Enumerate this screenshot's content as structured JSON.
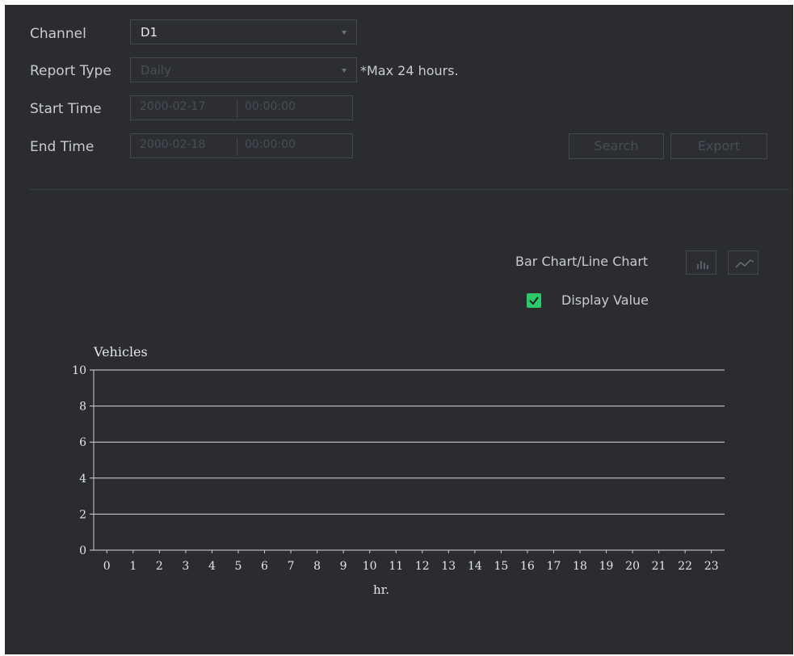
{
  "form": {
    "channel_label": "Channel",
    "channel_value": "D1",
    "report_type_label": "Report Type",
    "report_type_value": "Daily",
    "max_note": "*Max 24 hours.",
    "start_time_label": "Start Time",
    "start_date": "2000-02-17",
    "start_time": "00:00:00",
    "end_time_label": "End Time",
    "end_date": "2000-02-18",
    "end_time": "00:00:00",
    "search_label": "Search",
    "export_label": "Export"
  },
  "chart_controls": {
    "toggle_label": "Bar Chart/Line Chart",
    "display_value_label": "Display Value",
    "display_value_checked": true
  },
  "colors": {
    "panel_bg": "#2a2c30",
    "accent_green": "#2bc96b",
    "text": "#c9cbd0",
    "disabled": "#4a4d53"
  },
  "chart_data": {
    "type": "bar",
    "ylabel": "Vehicles",
    "xlabel": "hr.",
    "ylim": [
      0,
      10
    ],
    "yticks": [
      0,
      2,
      4,
      6,
      8,
      10
    ],
    "categories": [
      "0",
      "1",
      "2",
      "3",
      "4",
      "5",
      "6",
      "7",
      "8",
      "9",
      "10",
      "11",
      "12",
      "13",
      "14",
      "15",
      "16",
      "17",
      "18",
      "19",
      "20",
      "21",
      "22",
      "23"
    ],
    "series": [
      {
        "values": []
      }
    ],
    "grid": true
  }
}
